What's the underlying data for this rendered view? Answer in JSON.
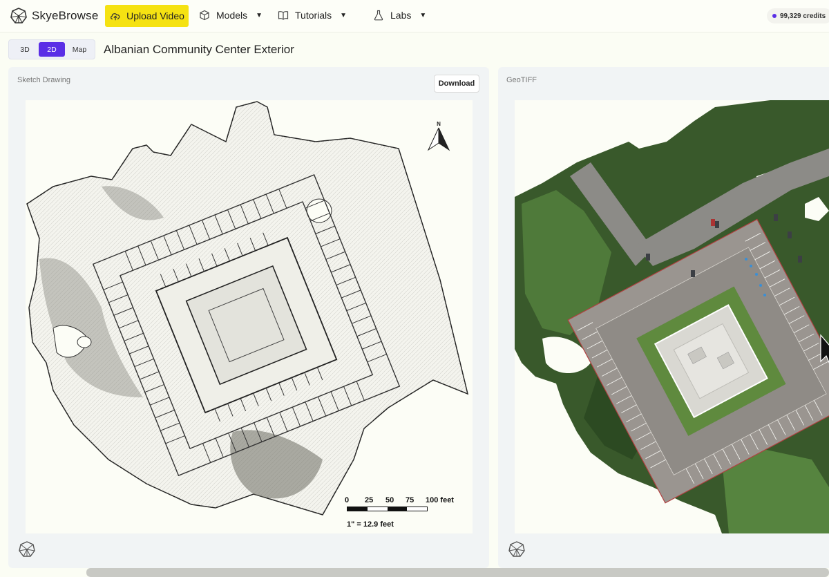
{
  "app": {
    "name": "SkyeBrowse"
  },
  "toolbar": {
    "upload_label": "Upload Video",
    "nav": [
      {
        "label": "Models",
        "icon": "cube-icon"
      },
      {
        "label": "Tutorials",
        "icon": "book-icon"
      },
      {
        "label": "Labs",
        "icon": "flask-icon"
      }
    ],
    "credits": "99,329 credits"
  },
  "view_toggle": {
    "options": [
      "3D",
      "2D",
      "Map"
    ],
    "selected": "2D"
  },
  "page": {
    "title": "Albanian Community Center Exterior"
  },
  "panels": {
    "sketch": {
      "title": "Sketch Drawing",
      "download_label": "Download",
      "north_label": "N",
      "scale": {
        "ticks": [
          "0",
          "25",
          "50",
          "75",
          "100 feet"
        ],
        "ratio": "1\" = 12.9 feet"
      }
    },
    "geotiff": {
      "title": "GeoTIFF"
    }
  },
  "colors": {
    "accent": "#5a2ee6",
    "upload": "#f5e212"
  }
}
